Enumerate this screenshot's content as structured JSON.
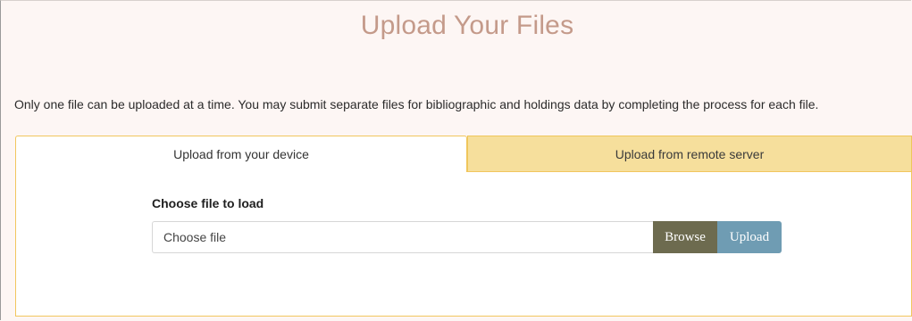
{
  "page": {
    "title": "Upload Your Files",
    "intro": "Only one file can be uploaded at a time. You may submit separate files for bibliographic and holdings data by completing the process for each file."
  },
  "tabs": [
    {
      "label": "Upload from your device",
      "active": true
    },
    {
      "label": "Upload from remote server",
      "active": false
    }
  ],
  "form": {
    "field_label": "Choose file to load",
    "file_placeholder": "Choose file",
    "browse_label": "Browse",
    "upload_label": "Upload"
  },
  "colors": {
    "title": "#c49a8a",
    "tab_border": "#f1c65e",
    "inactive_tab_bg": "#f6df9c",
    "browse_bg": "#6d6b4f",
    "upload_bg": "#6f9cb3",
    "page_bg": "#fdf6f4"
  }
}
